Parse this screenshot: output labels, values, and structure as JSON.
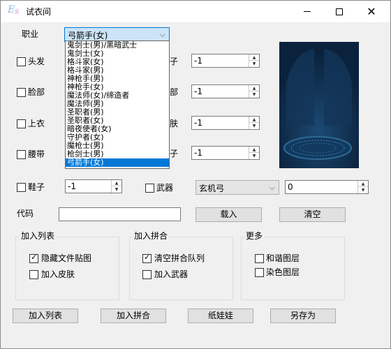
{
  "window": {
    "title": "试衣间",
    "icon_text": "E",
    "icon_sub": "S"
  },
  "profession": {
    "label": "职业",
    "selected": "弓箭手(女)",
    "options": [
      "鬼剑士(男)/黑暗武士",
      "鬼剑士(女)",
      "格斗家(女)",
      "格斗家(男)",
      "神枪手(男)",
      "神枪手(女)",
      "魔法师(女)/缔造者",
      "魔法师(男)",
      "圣职者(男)",
      "圣职者(女)",
      "暗夜使者(女)",
      "守护者(女)",
      "魔枪士(男)",
      "枪剑士(男)",
      "弓箭手(女)"
    ]
  },
  "slots": {
    "hair": {
      "label": "头发"
    },
    "face": {
      "label": "脸部"
    },
    "top": {
      "label": "上衣"
    },
    "belt": {
      "label": "腰带"
    },
    "shoes": {
      "label": "鞋子",
      "value": "-1"
    },
    "right_partial": [
      "子",
      "部",
      "肤",
      "子"
    ],
    "right_values": [
      "-1",
      "-1",
      "-1",
      "-1"
    ]
  },
  "weapon": {
    "label": "武器",
    "selected": "玄机弓",
    "value": "0"
  },
  "code": {
    "label": "代码",
    "value": "",
    "load_button": "载入",
    "clear_button": "清空"
  },
  "groups": {
    "list": {
      "title": "加入列表",
      "hide_label": "隐藏文件贴图",
      "hide_checked": true,
      "skin_label": "加入皮肤",
      "skin_checked": false
    },
    "merge": {
      "title": "加入拼合",
      "clear_label": "清空拼合队列",
      "clear_checked": true,
      "weapon_label": "加入武器",
      "weapon_checked": false
    },
    "more": {
      "title": "更多",
      "harmony_label": "和谐图层",
      "dye_label": "染色图层"
    }
  },
  "buttons": {
    "add_list": "加入列表",
    "add_merge": "加入拼合",
    "doll": "纸娃娃",
    "save_as": "另存为"
  }
}
